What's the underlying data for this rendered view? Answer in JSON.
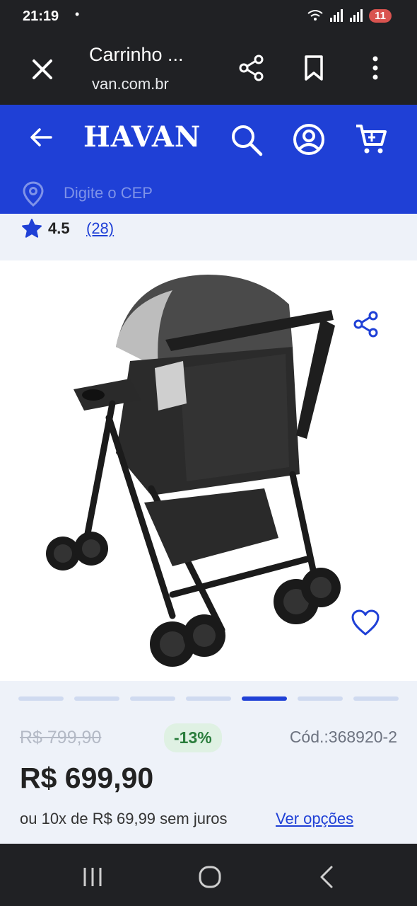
{
  "status_bar": {
    "time": "21:19",
    "dot": "•",
    "battery": "11"
  },
  "browser": {
    "title": "Carrinho ...",
    "url": "van.com.br",
    "icons": [
      "close-icon",
      "share-icon",
      "bookmark-icon",
      "more-vert-icon"
    ]
  },
  "header": {
    "logo": "HAVAN",
    "cep_placeholder": "Digite o CEP",
    "icons": [
      "arrow-left-icon",
      "search-icon",
      "account-icon",
      "cart-icon",
      "location-pin-icon"
    ]
  },
  "rating": {
    "value": "4.5",
    "count": "(28)"
  },
  "product": {
    "image": "baby stroller photo",
    "active_slide": 5,
    "slide_count": 7
  },
  "pricing": {
    "old_price": "R$ 799,90",
    "discount": "-13%",
    "sku": "Cód.:368920-2",
    "price": "R$ 699,90",
    "installments": "ou 10x de R$ 69,99 sem juros",
    "options_link": "Ver opções"
  },
  "colors": {
    "brand_blue": "#1f40d6",
    "dark_bar": "#202124",
    "discount_green": "#2a7d3c",
    "light_bg": "#eef2f9"
  }
}
